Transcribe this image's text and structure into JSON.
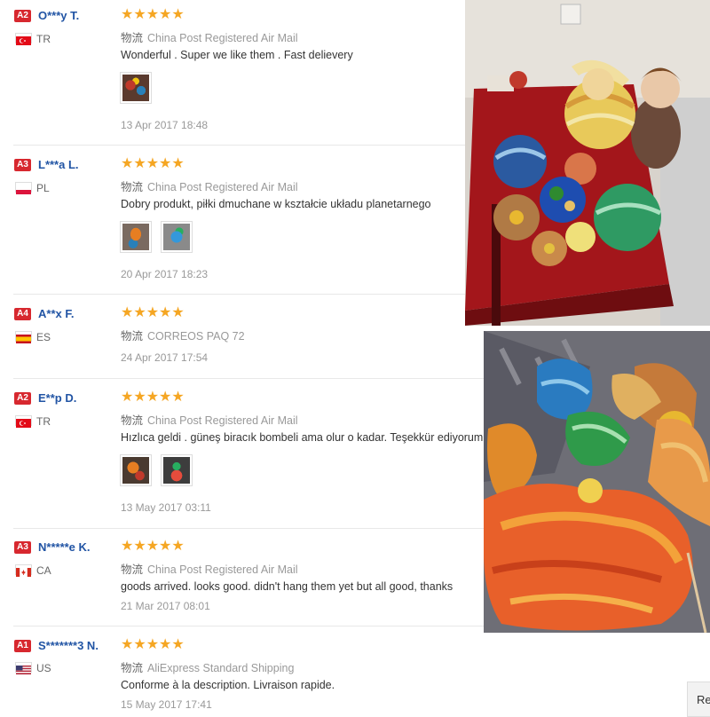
{
  "reviews": [
    {
      "level": "A2",
      "name": "O***y T.",
      "country": "TR",
      "flag": "tr",
      "shipping": "China Post Registered Air Mail",
      "feedback": "Wonderful . Super we like them . Fast delievery",
      "date": "13 Apr 2017 18:48",
      "rating": 5
    },
    {
      "level": "A3",
      "name": "L***a L.",
      "country": "PL",
      "flag": "pl",
      "shipping": "China Post Registered Air Mail",
      "feedback": "Dobry produkt, piłki dmuchane w kształcie układu planetarnego",
      "date": "20 Apr 2017 18:23",
      "rating": 5
    },
    {
      "level": "A4",
      "name": "A**x F.",
      "country": "ES",
      "flag": "es",
      "shipping": "CORREOS PAQ 72",
      "feedback": "",
      "date": "24 Apr 2017 17:54",
      "rating": 5
    },
    {
      "level": "A2",
      "name": "E**p D.",
      "country": "TR",
      "flag": "tr",
      "shipping": "China Post Registered Air Mail",
      "feedback": "Hızlıca geldi . güneş biracık bombeli ama olur o kadar. Teşekkür ediyorum",
      "date": "13 May 2017 03:11",
      "rating": 5
    },
    {
      "level": "A3",
      "name": "N*****e K.",
      "country": "CA",
      "flag": "ca",
      "shipping": "China Post Registered Air Mail",
      "feedback": "goods arrived. looks good. didn't hang them yet but all good, thanks",
      "date": "21 Mar 2017 08:01",
      "rating": 5
    },
    {
      "level": "A1",
      "name": "S*******3 N.",
      "country": "US",
      "flag": "us",
      "shipping": "AliExpress Standard Shipping",
      "feedback": "Conforme à la description. Livraison rapide.",
      "date": "15 May 2017 17:41",
      "rating": 5
    }
  ],
  "stars_glyph": "★★★★★",
  "logistics_label": "物流",
  "button_partial": "Re",
  "colors": {
    "level_badge": "#d7282f",
    "username": "#2154a4",
    "stars": "#f5a623"
  }
}
